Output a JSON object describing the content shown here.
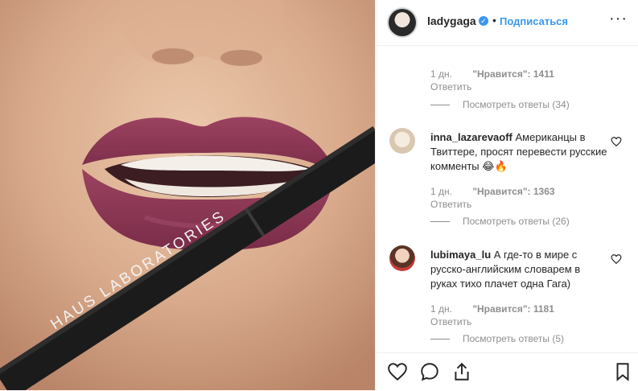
{
  "photo": {
    "brand_text": "HAUS LABORATORIES"
  },
  "header": {
    "username": "ladygaga",
    "verified_icon": "verified-badge-icon",
    "separator": "•",
    "follow_label": "Подписаться",
    "more_label": "···"
  },
  "comments": [
    {
      "ago": "1 дн.",
      "likes": "\"Нравится\": 1411",
      "reply": "Ответить",
      "view_replies": "Посмотреть ответы (34)"
    },
    {
      "username": "inna_lazarevaoff",
      "text": "Американцы в Твиттере, просят перевести русские комменты 😂🔥",
      "ago": "1 дн.",
      "likes": "\"Нравится\": 1363",
      "reply": "Ответить",
      "view_replies": "Посмотреть ответы (26)"
    },
    {
      "username": "lubimaya_lu",
      "text": "А где-то в мире с русско-английским словарем в руках тихо плачет одна Гага)",
      "ago": "1 дн.",
      "likes": "\"Нравится\": 1181",
      "reply": "Ответить",
      "view_replies": "Посмотреть ответы (5)"
    }
  ],
  "actions": {
    "like_icon": "heart-icon",
    "comment_icon": "comment-icon",
    "share_icon": "share-icon",
    "save_icon": "bookmark-icon"
  },
  "colors": {
    "accent": "#3897f0",
    "muted": "#8e8e8e",
    "text": "#262626",
    "lip": "#8a3552"
  }
}
